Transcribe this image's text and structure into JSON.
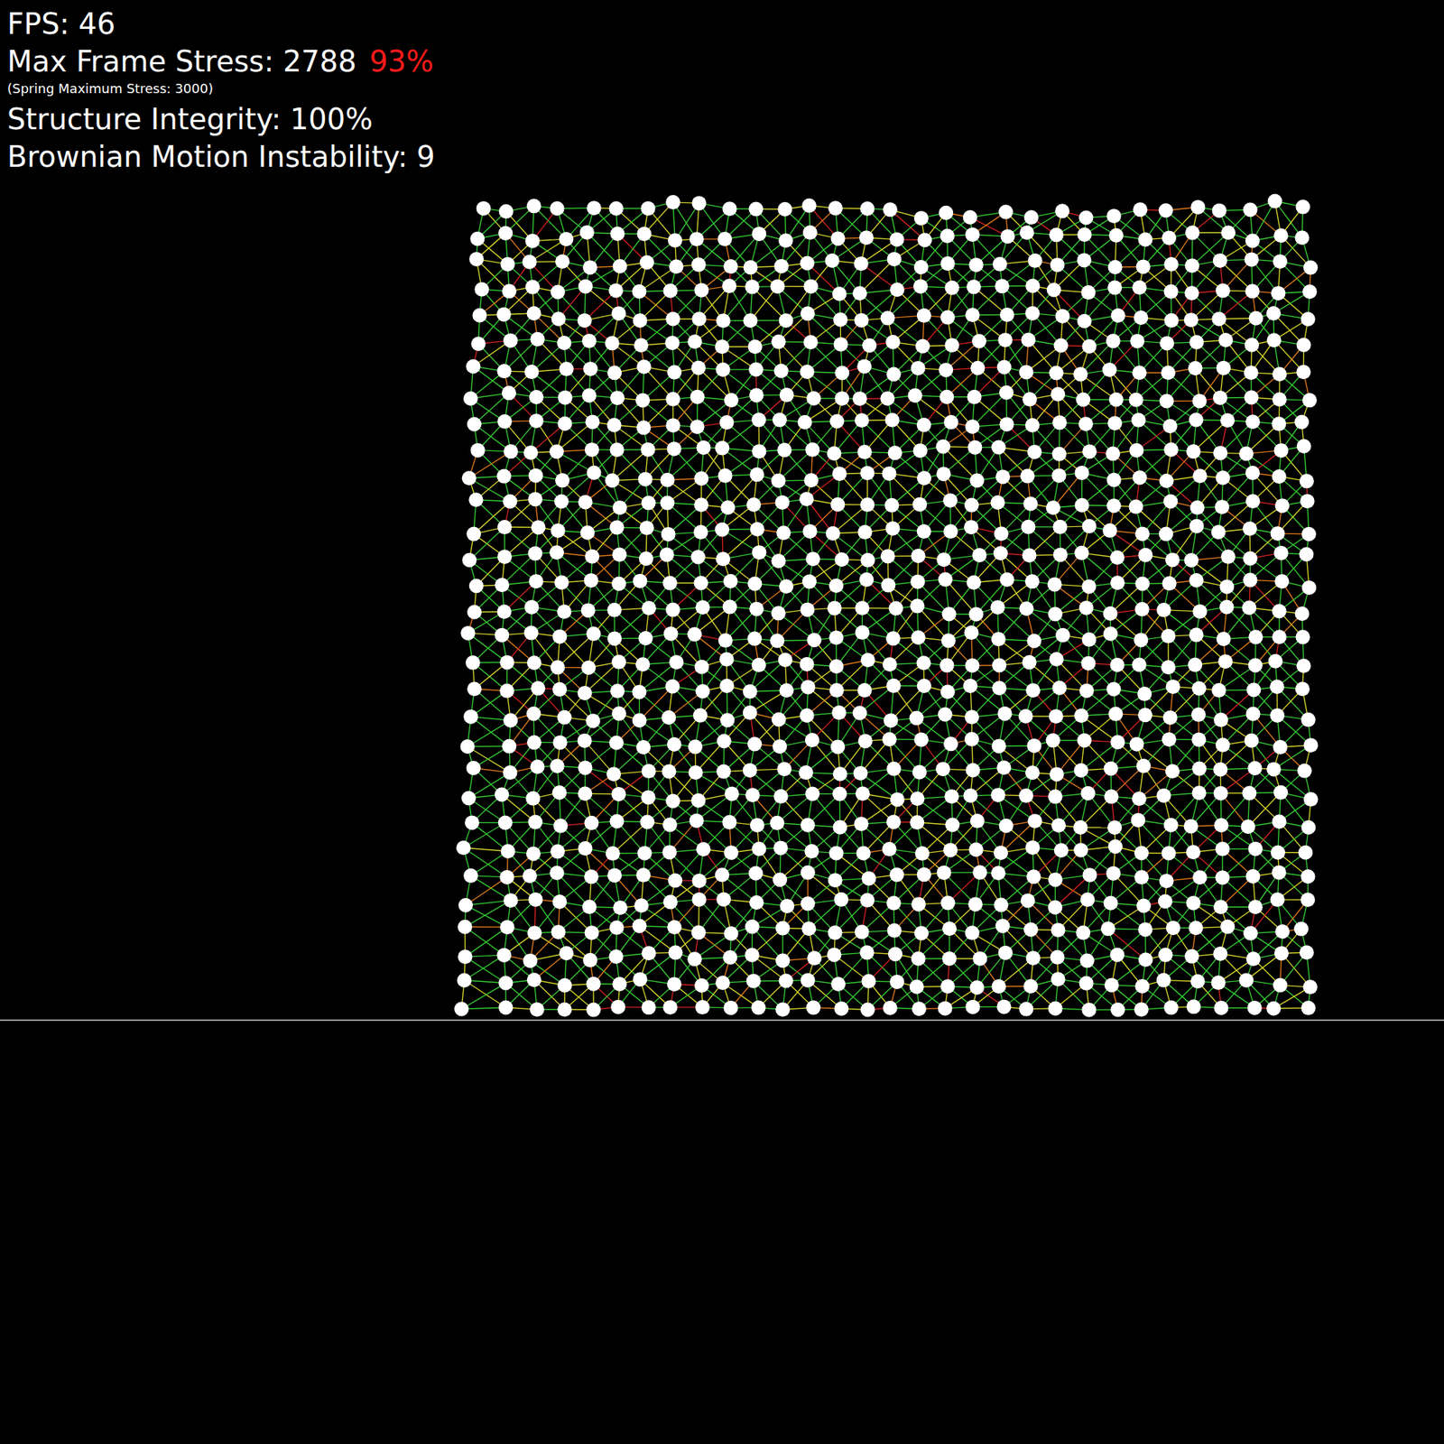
{
  "hud": {
    "fps": "FPS: 46",
    "max_stress": {
      "label": "Max Frame Stress: 2788",
      "percent": "93%"
    },
    "spring_max": "(Spring Maximum Stress: 3000)",
    "integrity": "Structure Integrity: 100%",
    "brownian": "Brownian Motion Instability: 9"
  },
  "mesh": {
    "columns": 31,
    "rows": 31
  }
}
